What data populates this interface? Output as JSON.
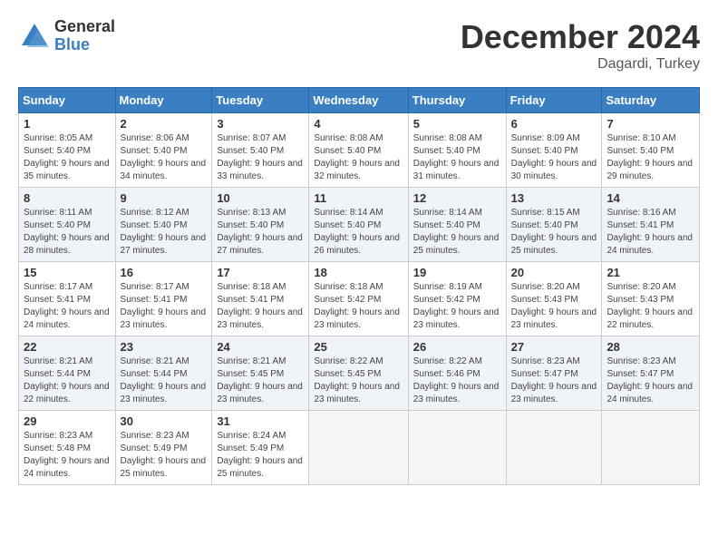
{
  "logo": {
    "general": "General",
    "blue": "Blue"
  },
  "title": "December 2024",
  "location": "Dagardi, Turkey",
  "days_of_week": [
    "Sunday",
    "Monday",
    "Tuesday",
    "Wednesday",
    "Thursday",
    "Friday",
    "Saturday"
  ],
  "weeks": [
    [
      {
        "day": "1",
        "sunrise": "8:05 AM",
        "sunset": "5:40 PM",
        "daylight": "9 hours and 35 minutes."
      },
      {
        "day": "2",
        "sunrise": "8:06 AM",
        "sunset": "5:40 PM",
        "daylight": "9 hours and 34 minutes."
      },
      {
        "day": "3",
        "sunrise": "8:07 AM",
        "sunset": "5:40 PM",
        "daylight": "9 hours and 33 minutes."
      },
      {
        "day": "4",
        "sunrise": "8:08 AM",
        "sunset": "5:40 PM",
        "daylight": "9 hours and 32 minutes."
      },
      {
        "day": "5",
        "sunrise": "8:08 AM",
        "sunset": "5:40 PM",
        "daylight": "9 hours and 31 minutes."
      },
      {
        "day": "6",
        "sunrise": "8:09 AM",
        "sunset": "5:40 PM",
        "daylight": "9 hours and 30 minutes."
      },
      {
        "day": "7",
        "sunrise": "8:10 AM",
        "sunset": "5:40 PM",
        "daylight": "9 hours and 29 minutes."
      }
    ],
    [
      {
        "day": "8",
        "sunrise": "8:11 AM",
        "sunset": "5:40 PM",
        "daylight": "9 hours and 28 minutes."
      },
      {
        "day": "9",
        "sunrise": "8:12 AM",
        "sunset": "5:40 PM",
        "daylight": "9 hours and 27 minutes."
      },
      {
        "day": "10",
        "sunrise": "8:13 AM",
        "sunset": "5:40 PM",
        "daylight": "9 hours and 27 minutes."
      },
      {
        "day": "11",
        "sunrise": "8:14 AM",
        "sunset": "5:40 PM",
        "daylight": "9 hours and 26 minutes."
      },
      {
        "day": "12",
        "sunrise": "8:14 AM",
        "sunset": "5:40 PM",
        "daylight": "9 hours and 25 minutes."
      },
      {
        "day": "13",
        "sunrise": "8:15 AM",
        "sunset": "5:40 PM",
        "daylight": "9 hours and 25 minutes."
      },
      {
        "day": "14",
        "sunrise": "8:16 AM",
        "sunset": "5:41 PM",
        "daylight": "9 hours and 24 minutes."
      }
    ],
    [
      {
        "day": "15",
        "sunrise": "8:17 AM",
        "sunset": "5:41 PM",
        "daylight": "9 hours and 24 minutes."
      },
      {
        "day": "16",
        "sunrise": "8:17 AM",
        "sunset": "5:41 PM",
        "daylight": "9 hours and 23 minutes."
      },
      {
        "day": "17",
        "sunrise": "8:18 AM",
        "sunset": "5:41 PM",
        "daylight": "9 hours and 23 minutes."
      },
      {
        "day": "18",
        "sunrise": "8:18 AM",
        "sunset": "5:42 PM",
        "daylight": "9 hours and 23 minutes."
      },
      {
        "day": "19",
        "sunrise": "8:19 AM",
        "sunset": "5:42 PM",
        "daylight": "9 hours and 23 minutes."
      },
      {
        "day": "20",
        "sunrise": "8:20 AM",
        "sunset": "5:43 PM",
        "daylight": "9 hours and 23 minutes."
      },
      {
        "day": "21",
        "sunrise": "8:20 AM",
        "sunset": "5:43 PM",
        "daylight": "9 hours and 22 minutes."
      }
    ],
    [
      {
        "day": "22",
        "sunrise": "8:21 AM",
        "sunset": "5:44 PM",
        "daylight": "9 hours and 22 minutes."
      },
      {
        "day": "23",
        "sunrise": "8:21 AM",
        "sunset": "5:44 PM",
        "daylight": "9 hours and 23 minutes."
      },
      {
        "day": "24",
        "sunrise": "8:21 AM",
        "sunset": "5:45 PM",
        "daylight": "9 hours and 23 minutes."
      },
      {
        "day": "25",
        "sunrise": "8:22 AM",
        "sunset": "5:45 PM",
        "daylight": "9 hours and 23 minutes."
      },
      {
        "day": "26",
        "sunrise": "8:22 AM",
        "sunset": "5:46 PM",
        "daylight": "9 hours and 23 minutes."
      },
      {
        "day": "27",
        "sunrise": "8:23 AM",
        "sunset": "5:47 PM",
        "daylight": "9 hours and 23 minutes."
      },
      {
        "day": "28",
        "sunrise": "8:23 AM",
        "sunset": "5:47 PM",
        "daylight": "9 hours and 24 minutes."
      }
    ],
    [
      {
        "day": "29",
        "sunrise": "8:23 AM",
        "sunset": "5:48 PM",
        "daylight": "9 hours and 24 minutes."
      },
      {
        "day": "30",
        "sunrise": "8:23 AM",
        "sunset": "5:49 PM",
        "daylight": "9 hours and 25 minutes."
      },
      {
        "day": "31",
        "sunrise": "8:24 AM",
        "sunset": "5:49 PM",
        "daylight": "9 hours and 25 minutes."
      },
      null,
      null,
      null,
      null
    ]
  ]
}
